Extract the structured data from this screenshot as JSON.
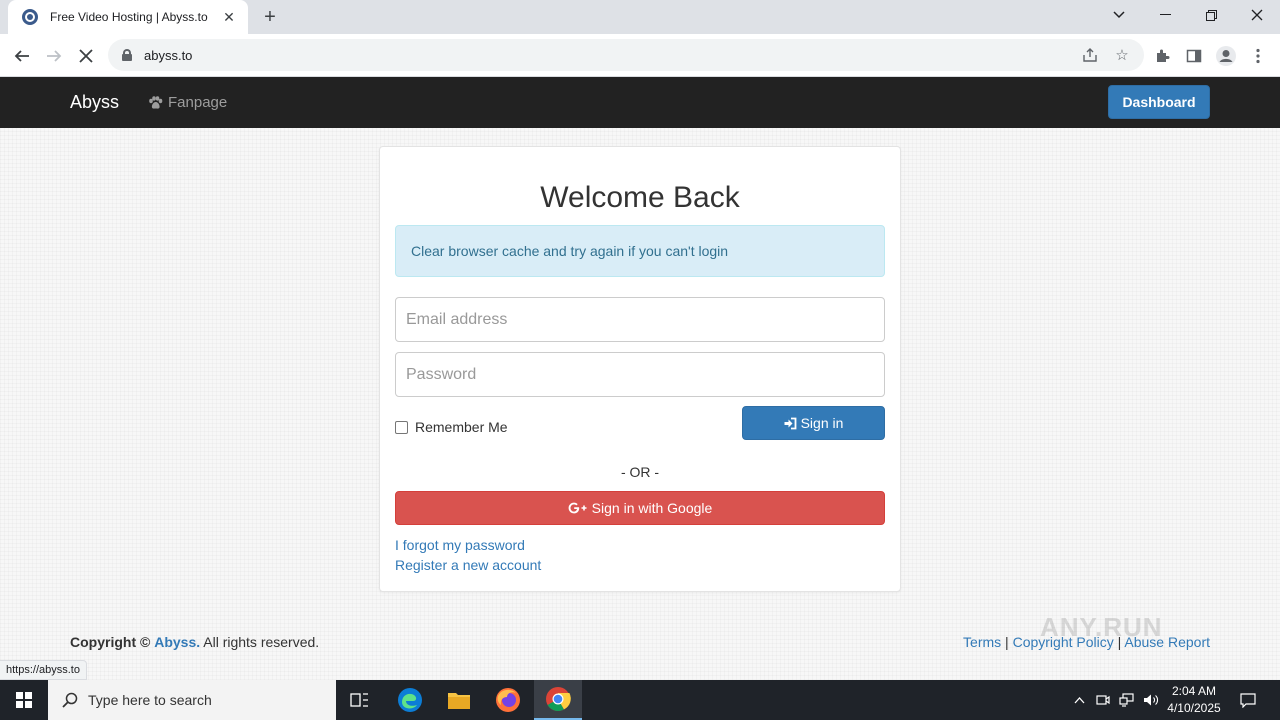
{
  "browser": {
    "tab_title": "Free Video Hosting | Abyss.to",
    "url": "abyss.to",
    "status_url": "https://abyss.to"
  },
  "navbar": {
    "brand": "Abyss",
    "fanpage": "Fanpage",
    "dashboard": "Dashboard"
  },
  "login": {
    "title": "Welcome Back",
    "alert": "Clear browser cache and try again if you can't login",
    "email_placeholder": "Email address",
    "password_placeholder": "Password",
    "remember": "Remember Me",
    "sign_in": "Sign in",
    "or": "- OR -",
    "google": "Sign in with Google",
    "forgot": "I forgot my password",
    "register": "Register a new account"
  },
  "footer": {
    "copyright_label": "Copyright ©",
    "brand": "Abyss.",
    "rights": "All rights reserved.",
    "terms": "Terms",
    "copyright_policy": "Copyright Policy",
    "abuse": "Abuse Report",
    "separator": "|"
  },
  "watermark": "ANY.RUN",
  "taskbar": {
    "search_placeholder": "Type here to search",
    "time": "2:04 AM",
    "date": "4/10/2025"
  },
  "colors": {
    "primary": "#337ab7",
    "danger": "#d9534f",
    "navbar": "#222222",
    "alert_bg": "#d9edf7"
  }
}
